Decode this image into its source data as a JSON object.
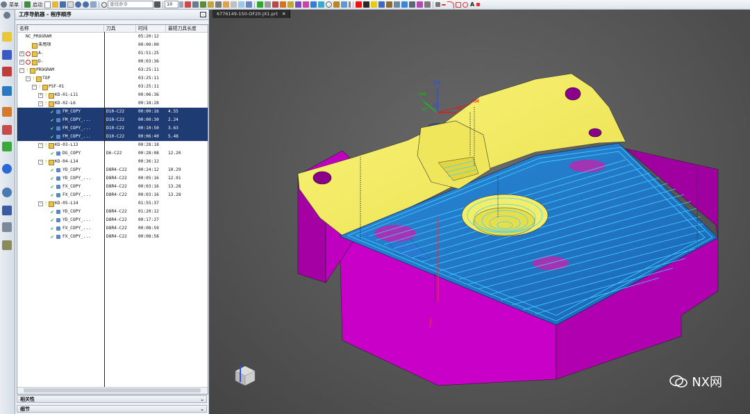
{
  "toolbar": {
    "menu_label": "菜单",
    "start_label": "启动",
    "search_placeholder": "查找命令",
    "zoom_value": "10"
  },
  "navigator": {
    "title": "工序导航器 - 程序顺序",
    "columns": [
      "名称",
      "刀具",
      "时间",
      "最短刀具长度"
    ],
    "rows": [
      {
        "indent": 0,
        "expand": "",
        "icon": "none",
        "name": "NC_PROGRAM",
        "tool": "",
        "time": "05:20:12",
        "length": "",
        "selected": false
      },
      {
        "indent": 1,
        "expand": "",
        "icon": "folder",
        "name": "未用项",
        "tool": "",
        "time": "00:00:00",
        "length": "",
        "selected": false
      },
      {
        "indent": 0,
        "expand": "+",
        "icon": "blocked-folder",
        "name": "A-",
        "tool": "",
        "time": "01:51:25",
        "length": "",
        "selected": false
      },
      {
        "indent": 0,
        "expand": "+",
        "icon": "blocked-folder",
        "name": "D-",
        "tool": "",
        "time": "00:03:36",
        "length": "",
        "selected": false
      },
      {
        "indent": 0,
        "expand": "-",
        "icon": "check-folder",
        "name": "PROGRAM",
        "tool": "",
        "time": "03:25:11",
        "length": "",
        "selected": false
      },
      {
        "indent": 1,
        "expand": "-",
        "icon": "check-folder",
        "name": "TOP",
        "tool": "",
        "time": "03:25:11",
        "length": "",
        "selected": false
      },
      {
        "indent": 2,
        "expand": "-",
        "icon": "check-folder",
        "name": "PSF-01",
        "tool": "",
        "time": "03:25:11",
        "length": "",
        "selected": false
      },
      {
        "indent": 3,
        "expand": "+",
        "icon": "check-folder",
        "name": "KD-01-L11",
        "tool": "",
        "time": "00:06:36",
        "length": "",
        "selected": false
      },
      {
        "indent": 3,
        "expand": "-",
        "icon": "check-folder",
        "name": "KD-02-L6",
        "tool": "",
        "time": "00:18:28",
        "length": "",
        "selected": false
      },
      {
        "indent": 4,
        "expand": "",
        "icon": "op",
        "name": "FM_COPY",
        "tool": "D10-C22",
        "time": "00:00:16",
        "length": "4.55",
        "selected": true
      },
      {
        "indent": 4,
        "expand": "",
        "icon": "op",
        "name": "FM_COPY_...",
        "tool": "D10-C22",
        "time": "00:00:30",
        "length": "2.24",
        "selected": true
      },
      {
        "indent": 4,
        "expand": "",
        "icon": "op",
        "name": "FM_COPY_...",
        "tool": "D10-C22",
        "time": "00:10:50",
        "length": "3.63",
        "selected": true
      },
      {
        "indent": 4,
        "expand": "",
        "icon": "op",
        "name": "FM_COPY_...",
        "tool": "D10-C22",
        "time": "00:06:40",
        "length": "5.48",
        "selected": true
      },
      {
        "indent": 3,
        "expand": "-",
        "icon": "check-folder",
        "name": "KD-03-L13",
        "tool": "",
        "time": "00:28:18",
        "length": "",
        "selected": false
      },
      {
        "indent": 4,
        "expand": "",
        "icon": "op",
        "name": "DG_COPY",
        "tool": "D6-C22",
        "time": "00:28:08",
        "length": "12.20",
        "selected": false
      },
      {
        "indent": 3,
        "expand": "-",
        "icon": "check-folder",
        "name": "KD-04-L14",
        "tool": "",
        "time": "00:36:12",
        "length": "",
        "selected": false
      },
      {
        "indent": 4,
        "expand": "",
        "icon": "op",
        "name": "YD_COPY",
        "tool": "D8R4-C22",
        "time": "00:24:12",
        "length": "10.29",
        "selected": false
      },
      {
        "indent": 4,
        "expand": "",
        "icon": "op",
        "name": "YD_COPY_...",
        "tool": "D8R4-C22",
        "time": "00:05:16",
        "length": "12.91",
        "selected": false
      },
      {
        "indent": 4,
        "expand": "",
        "icon": "op",
        "name": "FX_COPY",
        "tool": "D8R4-C22",
        "time": "00:03:16",
        "length": "13.28",
        "selected": false
      },
      {
        "indent": 4,
        "expand": "",
        "icon": "op",
        "name": "FX_COPY_...",
        "tool": "D8R4-C22",
        "time": "00:03:16",
        "length": "13.28",
        "selected": false
      },
      {
        "indent": 3,
        "expand": "-",
        "icon": "check-folder",
        "name": "KD-05-L14",
        "tool": "",
        "time": "01:55:37",
        "length": "",
        "selected": false
      },
      {
        "indent": 4,
        "expand": "",
        "icon": "op",
        "name": "YD_COPY",
        "tool": "D8R4-C22",
        "time": "01:20:12",
        "length": "",
        "selected": false
      },
      {
        "indent": 4,
        "expand": "",
        "icon": "op",
        "name": "YD_COPY_...",
        "tool": "D8R4-C22",
        "time": "00:17:27",
        "length": "",
        "selected": false
      },
      {
        "indent": 4,
        "expand": "",
        "icon": "op",
        "name": "FX_COPY_...",
        "tool": "D8R4-C22",
        "time": "00:08:59",
        "length": "",
        "selected": false
      },
      {
        "indent": 4,
        "expand": "",
        "icon": "op",
        "name": "FX_COPY_...",
        "tool": "D8R4-C22",
        "time": "00:08:58",
        "length": "",
        "selected": false
      }
    ],
    "panels": [
      {
        "label": "相关性"
      },
      {
        "label": "细节"
      }
    ]
  },
  "viewport": {
    "file_tab": "6776149-150-OF20-JX1.prt",
    "axis_labels": [
      "ZM",
      "YM",
      "XM",
      "ZC",
      "YC",
      "XC"
    ],
    "watermark": "NX网",
    "colors": {
      "top_face": "#f5f06a",
      "side_face": "#c400c4",
      "toolpath": "#19b8f0",
      "hole": "#8a008a"
    }
  }
}
